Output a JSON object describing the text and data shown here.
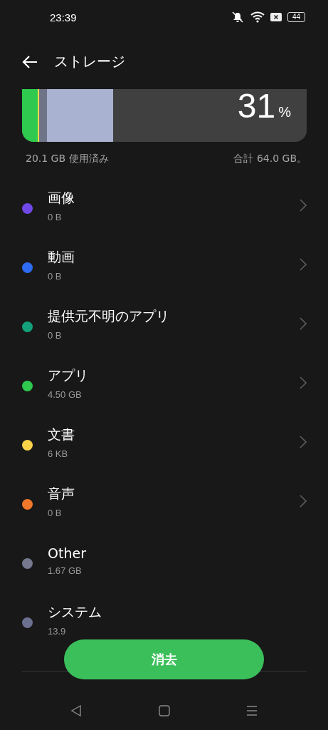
{
  "status_bar": {
    "time": "23:39",
    "battery": "44"
  },
  "header": {
    "title": "ストレージ"
  },
  "usage": {
    "percent": "31",
    "percent_sign": "%",
    "used": "20.1 GB 使用済み",
    "total": "合計 64.0 GB。",
    "segments": [
      {
        "color": "#2ec94e",
        "level": 0.055
      },
      {
        "color": "#f4dc4a",
        "level": 0.006
      },
      {
        "color": "#6f7488",
        "level": 0.027
      },
      {
        "color": "#a9b2d0",
        "level": 0.232
      }
    ]
  },
  "categories": [
    {
      "name": "画像",
      "size": "0 B",
      "color": "#7048e8",
      "chevron": true
    },
    {
      "name": "動画",
      "size": "0 B",
      "color": "#2f6bf0",
      "chevron": true
    },
    {
      "name": "提供元不明のアプリ",
      "size": "0 B",
      "color": "#14a07a",
      "chevron": true
    },
    {
      "name": "アプリ",
      "size": "4.50 GB",
      "color": "#2ec94e",
      "chevron": true
    },
    {
      "name": "文書",
      "size": "6 KB",
      "color": "#f8d34a",
      "chevron": true
    },
    {
      "name": "音声",
      "size": "0 B",
      "color": "#f0782a",
      "chevron": true
    },
    {
      "name": "Other",
      "size": "1.67 GB",
      "color": "#767a8e",
      "chevron": false
    },
    {
      "name": "システム",
      "size": "13.9",
      "color": "#6c7190",
      "chevron": false
    }
  ],
  "button": {
    "label": "消去"
  }
}
